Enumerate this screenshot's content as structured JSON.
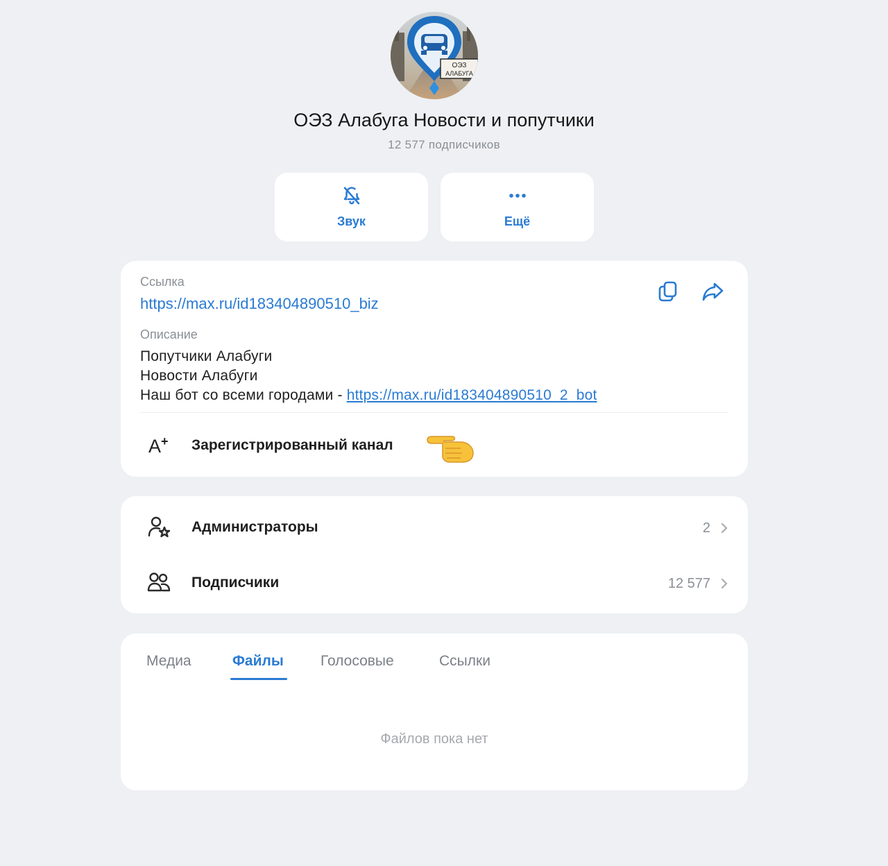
{
  "channel": {
    "avatar_text_line1": "ОЭЗ",
    "avatar_text_line2": "АЛАБУГА",
    "title": "ОЭЗ Алабуга Новости и попутчики",
    "subscribers_text": "12 577 подписчиков"
  },
  "actions": {
    "sound_label": "Звук",
    "more_label": "Ещё"
  },
  "info": {
    "link_label": "Ссылка",
    "link_url": "https://max.ru/id183404890510_biz",
    "description_label": "Описание",
    "description_line1": "Попутчики Алабуги",
    "description_line2": "Новости Алабуги",
    "description_line3_prefix": "Наш бот со всеми городами - ",
    "description_bot_link": "https://max.ru/id183404890510_2_bot",
    "registered_label": "Зарегистрированный канал"
  },
  "people": {
    "admins_label": "Администраторы",
    "admins_count": "2",
    "subscribers_label": "Подписчики",
    "subscribers_count": "12 577"
  },
  "tabs": {
    "media": "Медиа",
    "files": "Файлы",
    "voice": "Голосовые",
    "links": "Ссылки",
    "active": "files",
    "empty_message": "Файлов пока нет"
  },
  "colors": {
    "accent": "#2a7bd3",
    "background": "#eef0f3",
    "card": "#ffffff",
    "muted_text": "#8a8f96"
  }
}
